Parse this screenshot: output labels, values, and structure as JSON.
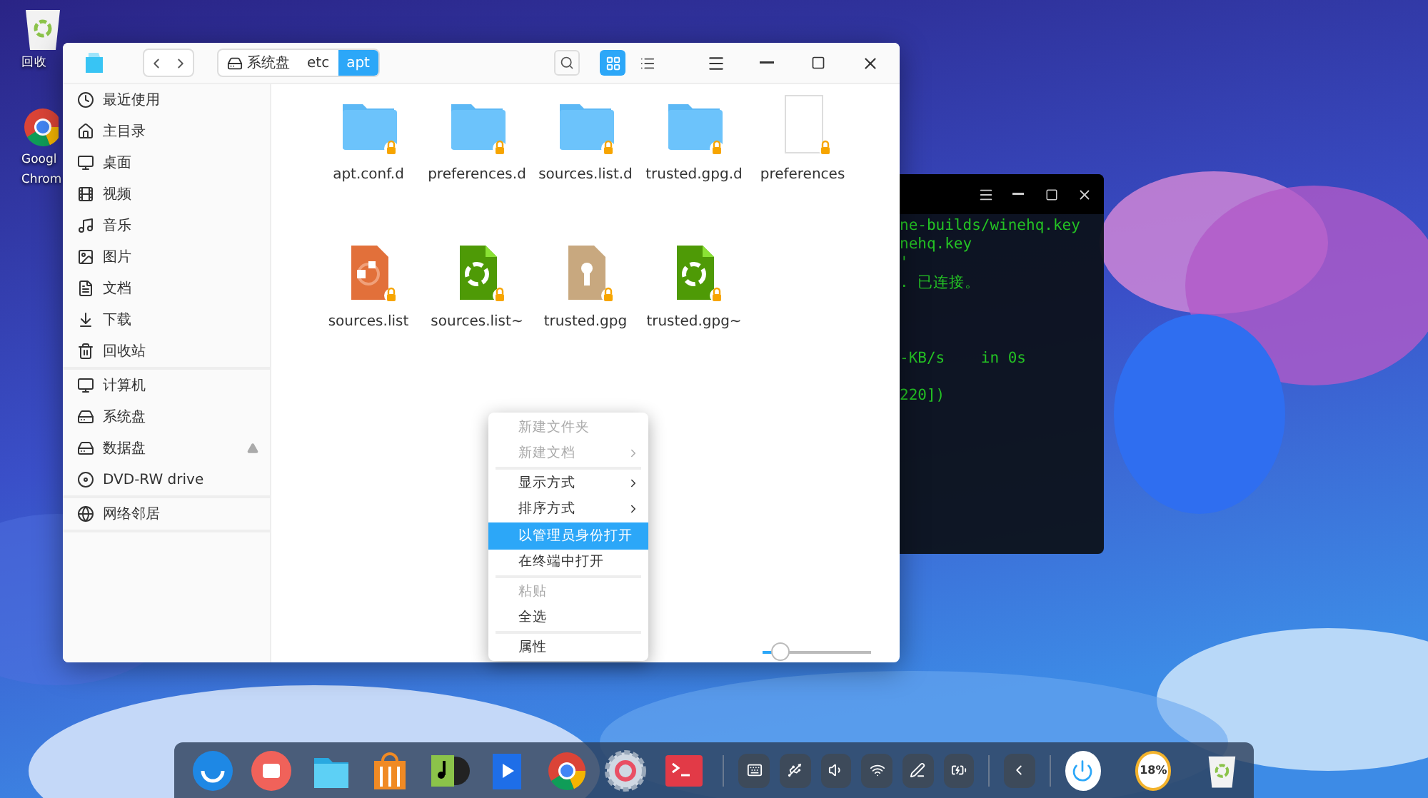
{
  "desktop_icons": [
    {
      "kind": "trash",
      "lines": [
        "回收"
      ]
    },
    {
      "kind": "chrome",
      "lines": [
        "Googl",
        "Chrom"
      ]
    }
  ],
  "file_manager": {
    "breadcrumb": [
      {
        "label": "系统盘",
        "selected": false
      },
      {
        "label": "etc",
        "selected": false
      },
      {
        "label": "apt",
        "selected": true
      }
    ],
    "view_modes": [
      {
        "kind": "grid",
        "selected": true
      },
      {
        "kind": "list",
        "selected": false
      }
    ],
    "sidebar": [
      [
        {
          "kind": "recent",
          "label": "最近使用"
        },
        {
          "kind": "home",
          "label": "主目录"
        },
        {
          "kind": "desktop",
          "label": "桌面"
        },
        {
          "kind": "video",
          "label": "视频"
        },
        {
          "kind": "music",
          "label": "音乐"
        },
        {
          "kind": "pictures",
          "label": "图片"
        },
        {
          "kind": "documents",
          "label": "文档"
        },
        {
          "kind": "downloads",
          "label": "下载"
        },
        {
          "kind": "trash",
          "label": "回收站"
        }
      ],
      [
        {
          "kind": "computer",
          "label": "计算机",
          "ejectable": false
        },
        {
          "kind": "disk",
          "label": "系统盘",
          "ejectable": false
        },
        {
          "kind": "disk",
          "label": "数据盘",
          "ejectable": true
        },
        {
          "kind": "dvd",
          "label": "DVD-RW drive",
          "ejectable": false
        }
      ],
      [
        {
          "kind": "network",
          "label": "网络邻居"
        }
      ]
    ],
    "files": [
      {
        "kind": "folder",
        "name": "apt.conf.d"
      },
      {
        "kind": "folder",
        "name": "preferences.d"
      },
      {
        "kind": "folder",
        "name": "sources.list.d"
      },
      {
        "kind": "folder",
        "name": "trusted.gpg.d"
      },
      {
        "kind": "blank",
        "name": "preferences"
      },
      {
        "kind": "source",
        "name": "sources.list"
      },
      {
        "kind": "backup",
        "name": "sources.list~"
      },
      {
        "kind": "key",
        "name": "trusted.gpg"
      },
      {
        "kind": "backup",
        "name": "trusted.gpg~"
      }
    ],
    "icon_size": {
      "level": 0.1
    }
  },
  "terminal": {
    "blocks": [
      [
        "ne-builds/winehq.key",
        "nehq.key",
        "'",
        ". 已连接。"
      ],
      [
        "-KB/s    in 0s"
      ],
      [
        "220])"
      ]
    ]
  },
  "context_menu": [
    [
      {
        "label": "新建文件夹",
        "disabled": true,
        "submenu": false,
        "selected": false
      },
      {
        "label": "新建文档",
        "disabled": true,
        "submenu": true,
        "selected": false
      }
    ],
    [
      {
        "label": "显示方式",
        "disabled": false,
        "submenu": true,
        "selected": false
      },
      {
        "label": "排序方式",
        "disabled": false,
        "submenu": true,
        "selected": false
      },
      {
        "label": "以管理员身份打开",
        "disabled": false,
        "submenu": false,
        "selected": true
      },
      {
        "label": "在终端中打开",
        "disabled": false,
        "submenu": false,
        "selected": false
      }
    ],
    [
      {
        "label": "粘贴",
        "disabled": true,
        "submenu": false,
        "selected": false
      },
      {
        "label": "全选",
        "disabled": false,
        "submenu": false,
        "selected": false
      }
    ],
    [
      {
        "label": "属性",
        "disabled": false,
        "submenu": false,
        "selected": false
      }
    ]
  ],
  "dock": {
    "apps": [
      {
        "kind": "launcher"
      },
      {
        "kind": "recorder"
      },
      {
        "kind": "files"
      },
      {
        "kind": "store"
      },
      {
        "kind": "music"
      },
      {
        "kind": "video"
      },
      {
        "kind": "browser"
      },
      {
        "kind": "settings"
      },
      {
        "kind": "terminal"
      }
    ],
    "tray": [
      {
        "kind": "keyboard"
      },
      {
        "kind": "usb"
      },
      {
        "kind": "volume"
      },
      {
        "kind": "wifi"
      },
      {
        "kind": "pen"
      },
      {
        "kind": "battery"
      },
      {
        "kind": "collapse"
      }
    ],
    "battery_text": "18%"
  }
}
